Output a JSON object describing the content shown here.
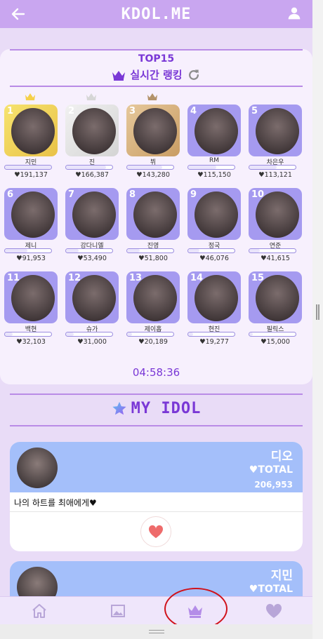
{
  "app": {
    "title": "KDOL.ME"
  },
  "ranking": {
    "top_label": "TOP15",
    "realtime_label": "실시간 랭킹",
    "idols": [
      {
        "rank": "1",
        "name": "지민",
        "hearts": "♥191,137",
        "level": 1.0
      },
      {
        "rank": "2",
        "name": "진",
        "hearts": "♥166,387",
        "level": 0.87
      },
      {
        "rank": "3",
        "name": "뷔",
        "hearts": "♥143,280",
        "level": 0.75
      },
      {
        "rank": "4",
        "name": "RM",
        "hearts": "♥115,150",
        "level": 0.6
      },
      {
        "rank": "5",
        "name": "차은우",
        "hearts": "♥113,121",
        "level": 0.59
      },
      {
        "rank": "6",
        "name": "제니",
        "hearts": "♥91,953",
        "level": 0.48
      },
      {
        "rank": "7",
        "name": "강다니엘",
        "hearts": "♥53,490",
        "level": 0.28
      },
      {
        "rank": "8",
        "name": "진영",
        "hearts": "♥51,800",
        "level": 0.27
      },
      {
        "rank": "9",
        "name": "정국",
        "hearts": "♥46,076",
        "level": 0.24
      },
      {
        "rank": "10",
        "name": "연준",
        "hearts": "♥41,615",
        "level": 0.22
      },
      {
        "rank": "11",
        "name": "백현",
        "hearts": "♥32,103",
        "level": 0.17
      },
      {
        "rank": "12",
        "name": "슈가",
        "hearts": "♥31,000",
        "level": 0.16
      },
      {
        "rank": "13",
        "name": "제이홉",
        "hearts": "♥20,189",
        "level": 0.11
      },
      {
        "rank": "14",
        "name": "현진",
        "hearts": "♥19,277",
        "level": 0.1
      },
      {
        "rank": "15",
        "name": "필릭스",
        "hearts": "♥15,000",
        "level": 0.08
      }
    ]
  },
  "timer": "04:58:36",
  "my_idol": {
    "title": "MY IDOL",
    "cards": [
      {
        "name": "디오",
        "total_label": "♥TOTAL",
        "total": "206,953",
        "message": "나의 하트를 최애에게♥"
      },
      {
        "name": "지민",
        "total_label": "♥TOTAL"
      }
    ]
  },
  "colors": {
    "accent": "#7a38d6",
    "header": "#c9a6f0",
    "tile": "#a59af0",
    "card_head": "#a4bffa",
    "heart": "#ee6b6b"
  },
  "icons": [
    "back-arrow-icon",
    "user-icon",
    "crown-icon",
    "refresh-icon",
    "star-icon",
    "heart-icon",
    "home-icon",
    "image-icon"
  ]
}
